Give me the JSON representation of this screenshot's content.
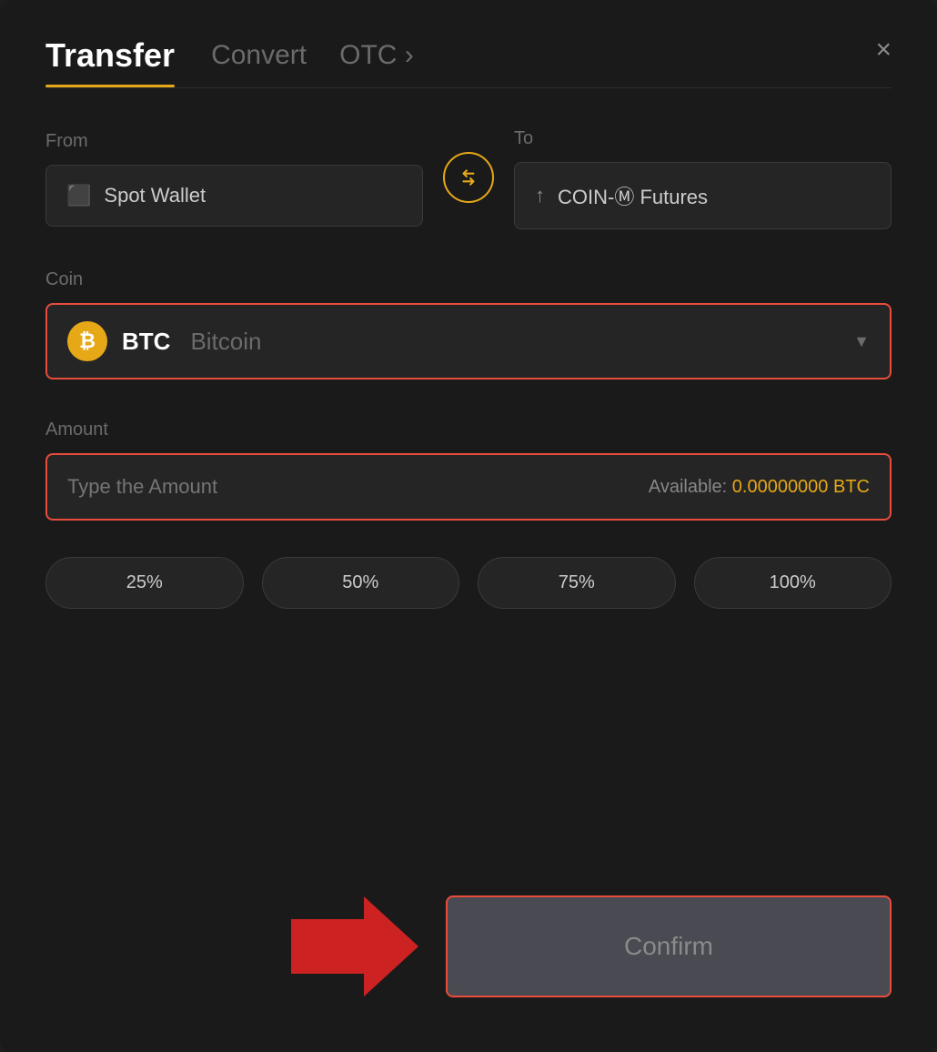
{
  "modal": {
    "title": "Transfer"
  },
  "tabs": {
    "transfer": "Transfer",
    "convert": "Convert",
    "otc": "OTC ›"
  },
  "close_label": "×",
  "from_label": "From",
  "to_label": "To",
  "from_wallet": "Spot Wallet",
  "to_wallet": "COIN-Ⓜ Futures",
  "coin_label": "Coin",
  "coin_ticker": "BTC",
  "coin_name": "Bitcoin",
  "amount_label": "Amount",
  "amount_placeholder": "Type the Amount",
  "available_label": "Available:",
  "available_value": "0.00000000 BTC",
  "pct_buttons": [
    "25%",
    "50%",
    "75%",
    "100%"
  ],
  "confirm_label": "Confirm",
  "colors": {
    "accent": "#e6a817",
    "danger": "#e74c3c",
    "confirm_bg": "#4a4a52"
  }
}
